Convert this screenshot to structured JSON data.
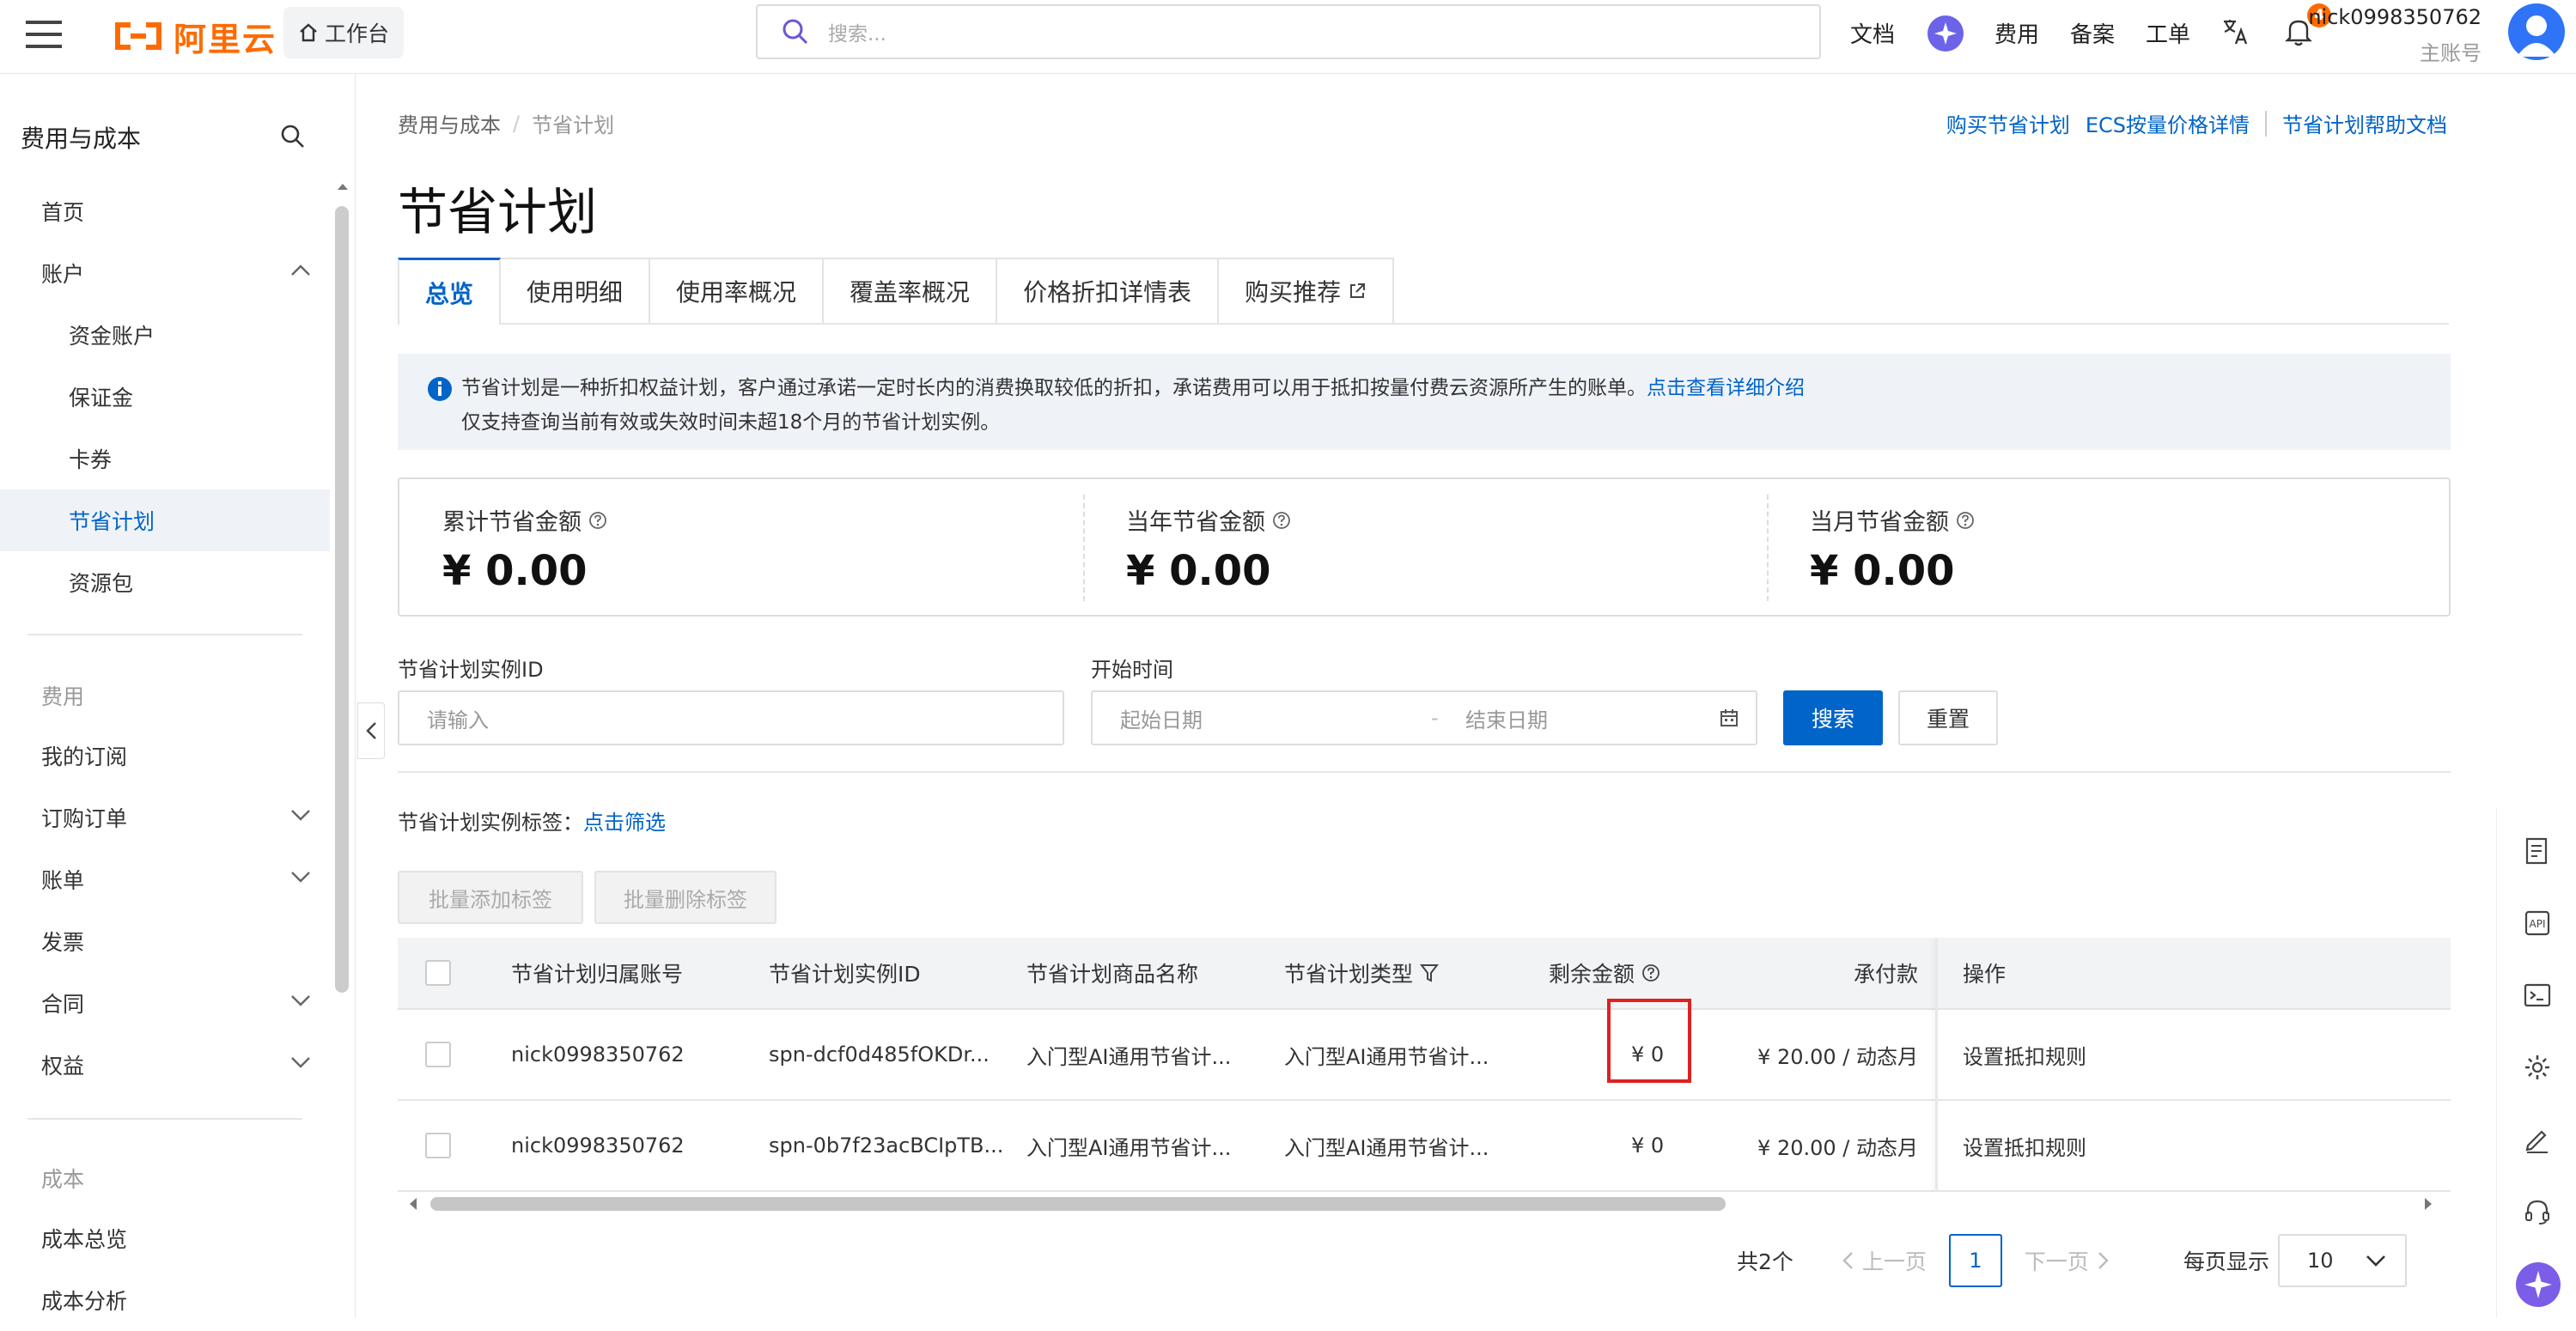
{
  "header": {
    "logo_text": "阿里云",
    "workbench_label": "工作台",
    "search_placeholder": "搜索...",
    "links": {
      "docs": "文档",
      "fees": "费用",
      "beian": "备案",
      "tickets": "工单"
    },
    "notification_count": "4",
    "user_name": "nick0998350762",
    "user_role": "主账号"
  },
  "sidebar": {
    "title": "费用与成本",
    "items": {
      "home": "首页",
      "account": "账户",
      "fund_account": "资金账户",
      "deposit": "保证金",
      "coupons": "卡券",
      "savings_plan": "节省计划",
      "resource_pack": "资源包",
      "fees_group": "费用",
      "my_subscriptions": "我的订阅",
      "orders": "订购订单",
      "bills": "账单",
      "invoice": "发票",
      "contract": "合同",
      "benefits": "权益",
      "cost_group": "成本",
      "cost_overview": "成本总览",
      "cost_analysis": "成本分析"
    }
  },
  "main": {
    "breadcrumb": {
      "parent": "费用与成本",
      "sep": "/",
      "current": "节省计划"
    },
    "top_links": {
      "buy": "购买节省计划",
      "ecs_price": "ECS按量价格详情",
      "help": "节省计划帮助文档"
    },
    "page_title": "节省计划",
    "tabs": [
      "总览",
      "使用明细",
      "使用率概况",
      "覆盖率概况",
      "价格折扣详情表",
      "购买推荐"
    ],
    "notice": {
      "line1": "节省计划是一种折扣权益计划，客户通过承诺一定时长内的消费换取较低的折扣，承诺费用可以用于抵扣按量付费云资源所产生的账单。",
      "link": "点击查看详细介绍",
      "line2": "仅支持查询当前有效或失效时间未超18个月的节省计划实例。"
    },
    "stats": [
      {
        "label": "累计节省金额",
        "value": "¥ 0.00"
      },
      {
        "label": "当年节省金额",
        "value": "¥ 0.00"
      },
      {
        "label": "当月节省金额",
        "value": "¥ 0.00"
      }
    ],
    "filters": {
      "instance_id_label": "节省计划实例ID",
      "instance_id_placeholder": "请输入",
      "time_label": "开始时间",
      "start_placeholder": "起始日期",
      "range_sep": "-",
      "end_placeholder": "结束日期",
      "search_btn": "搜索",
      "reset_btn": "重置"
    },
    "tag_filter": {
      "label": "节省计划实例标签：",
      "link": "点击筛选"
    },
    "batch": {
      "add": "批量添加标签",
      "remove": "批量删除标签"
    },
    "table": {
      "headers": {
        "account": "节省计划归属账号",
        "instance_id": "节省计划实例ID",
        "product": "节省计划商品名称",
        "type": "节省计划类型",
        "remaining": "剩余金额",
        "commitment": "承付款",
        "actions": "操作"
      },
      "rows": [
        {
          "account": "nick0998350762",
          "instance_id": "spn-dcf0d485fOKDr...",
          "product": "入门型AI通用节省计...",
          "type": "入门型AI通用节省计...",
          "remaining": "¥ 0",
          "commitment": "¥ 20.00 / 动态月",
          "action": "设置抵扣规则"
        },
        {
          "account": "nick0998350762",
          "instance_id": "spn-0b7f23acBCIpTB...",
          "product": "入门型AI通用节省计...",
          "type": "入门型AI通用节省计...",
          "remaining": "¥ 0",
          "commitment": "¥ 20.00 / 动态月",
          "action": "设置抵扣规则"
        }
      ]
    },
    "pagination": {
      "total": "共2个",
      "prev": "上一页",
      "current": "1",
      "next": "下一页",
      "page_size_label": "每页显示",
      "page_size": "10"
    }
  },
  "colors": {
    "brand": "#ff6a00",
    "link": "#0064c8",
    "highlight": "#e02020"
  }
}
